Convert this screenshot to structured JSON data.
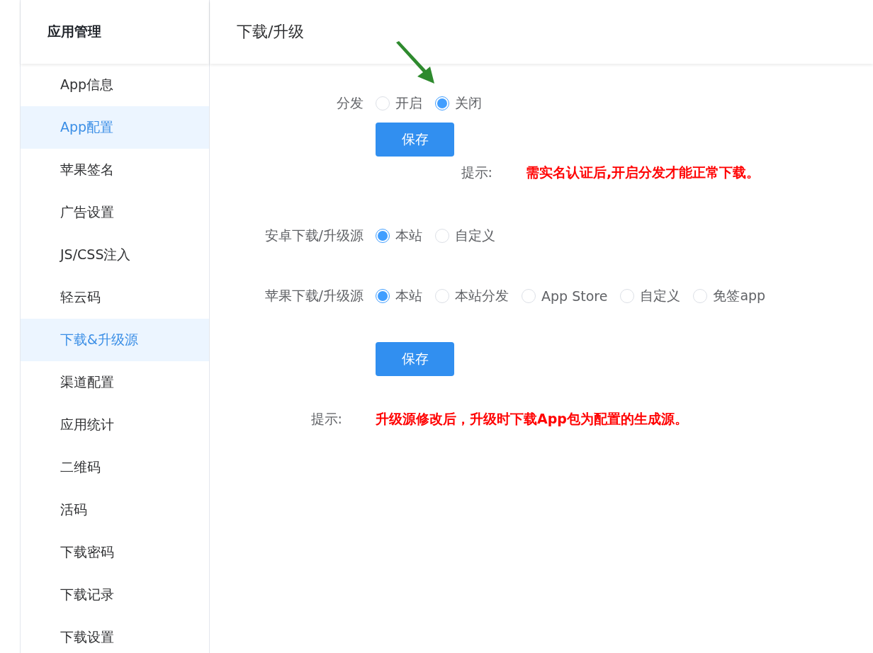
{
  "sidebar": {
    "title": "应用管理",
    "items": [
      {
        "label": "App信息",
        "selected": false
      },
      {
        "label": "App配置",
        "selected": true
      },
      {
        "label": "苹果签名",
        "selected": false
      },
      {
        "label": "广告设置",
        "selected": false
      },
      {
        "label": "JS/CSS注入",
        "selected": false
      },
      {
        "label": "轻云码",
        "selected": false
      },
      {
        "label": "下载&升级源",
        "selected": true
      },
      {
        "label": "渠道配置",
        "selected": false
      },
      {
        "label": "应用统计",
        "selected": false
      },
      {
        "label": "二维码",
        "selected": false
      },
      {
        "label": "活码",
        "selected": false
      },
      {
        "label": "下载密码",
        "selected": false
      },
      {
        "label": "下载记录",
        "selected": false
      },
      {
        "label": "下载设置",
        "selected": false
      }
    ]
  },
  "page_title": "下载/升级",
  "forms": [
    {
      "rows": [
        {
          "kind": "radio",
          "label": "分发",
          "options": [
            {
              "label": "开启",
              "selected": false
            },
            {
              "label": "关闭",
              "selected": true
            }
          ]
        },
        {
          "kind": "button",
          "label": "保存"
        },
        {
          "kind": "indented-tip",
          "label": "提示:",
          "text": "需实名认证后,开启分发才能正常下载。"
        }
      ]
    },
    {
      "rows": [
        {
          "kind": "radio",
          "label": "安卓下载/升级源",
          "options": [
            {
              "label": "本站",
              "selected": true
            },
            {
              "label": "自定义",
              "selected": false
            }
          ]
        },
        {
          "kind": "radio",
          "label": "苹果下载/升级源",
          "options": [
            {
              "label": "本站",
              "selected": true
            },
            {
              "label": "本站分发",
              "selected": false
            },
            {
              "label": "App Store",
              "selected": false
            },
            {
              "label": "自定义",
              "selected": false
            },
            {
              "label": "免签app",
              "selected": false
            }
          ]
        },
        {
          "kind": "button",
          "label": "保存"
        },
        {
          "kind": "tip",
          "label": "提示:",
          "text": "升级源修改后，升级时下载App包为配置的生成源。"
        }
      ]
    }
  ]
}
